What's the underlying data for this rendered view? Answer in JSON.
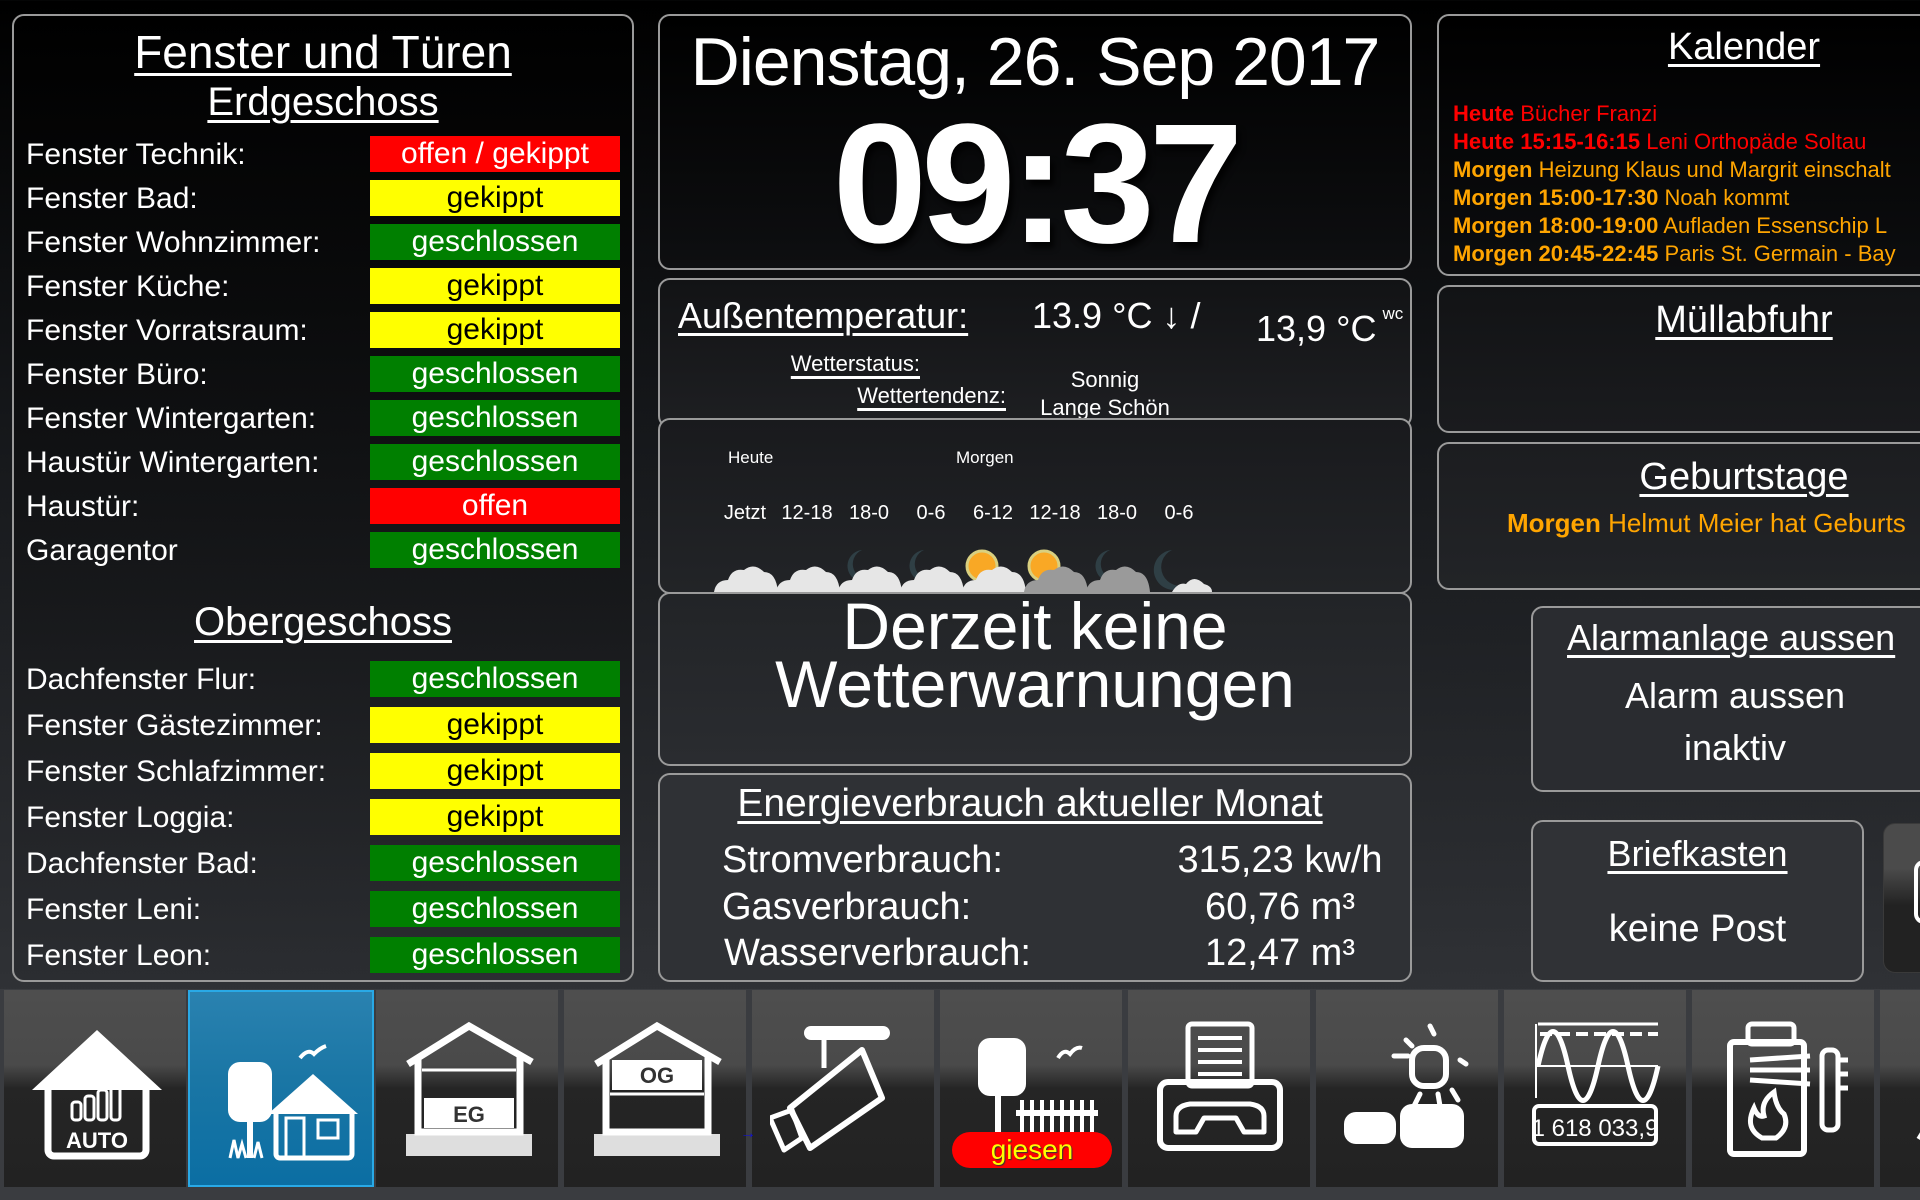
{
  "doors": {
    "title": "Fenster und Türen",
    "eg_title": "Erdgeschoss",
    "og_title": "Obergeschoss",
    "erdgeschoss": [
      {
        "label": "Fenster Technik:",
        "state": "offen / gekippt",
        "color": "red"
      },
      {
        "label": "Fenster Bad:",
        "state": "gekippt",
        "color": "yellow"
      },
      {
        "label": "Fenster Wohnzimmer:",
        "state": "geschlossen",
        "color": "green"
      },
      {
        "label": "Fenster Küche:",
        "state": "gekippt",
        "color": "yellow"
      },
      {
        "label": "Fenster Vorratsraum:",
        "state": "gekippt",
        "color": "yellow"
      },
      {
        "label": "Fenster Büro:",
        "state": "geschlossen",
        "color": "green"
      },
      {
        "label": "Fenster Wintergarten:",
        "state": "geschlossen",
        "color": "green"
      },
      {
        "label": "Haustür Wintergarten:",
        "state": "geschlossen",
        "color": "green"
      },
      {
        "label": "Haustür:",
        "state": "offen",
        "color": "red"
      },
      {
        "label": "Garagentor",
        "state": "geschlossen",
        "color": "green"
      }
    ],
    "obergeschoss": [
      {
        "label": "Dachfenster Flur:",
        "state": "geschlossen",
        "color": "green"
      },
      {
        "label": "Fenster Gästezimmer:",
        "state": "gekippt",
        "color": "yellow"
      },
      {
        "label": "Fenster Schlafzimmer:",
        "state": "gekippt",
        "color": "yellow"
      },
      {
        "label": "Fenster Loggia:",
        "state": "gekippt",
        "color": "yellow"
      },
      {
        "label": "Dachfenster Bad:",
        "state": "geschlossen",
        "color": "green"
      },
      {
        "label": "Fenster Leni:",
        "state": "geschlossen",
        "color": "green"
      },
      {
        "label": "Fenster Leon:",
        "state": "geschlossen",
        "color": "green"
      }
    ]
  },
  "status_colors": {
    "red": "#ff0000",
    "yellow": "#ffff00",
    "green": "#007f00"
  },
  "clock": {
    "date": "Dienstag, 26. Sep 2017",
    "time": "09:37"
  },
  "weather": {
    "temp_label": "Außentemperatur:",
    "temp_value": "13.9 °C ↓  /",
    "windchill_value": "13,9 °C",
    "windchill_suffix": "WC",
    "status_label": "Wetterstatus:",
    "status_value": "Sonnig",
    "trend_label": "Wettertendenz:",
    "trend_value": "Lange Schön",
    "forecast_days": [
      "Heute",
      "Morgen"
    ],
    "forecast": [
      {
        "slot": "Jetzt",
        "icon": "cloudy-icon"
      },
      {
        "slot": "12-18",
        "icon": "cloudy-icon"
      },
      {
        "slot": "18-0",
        "icon": "night-cloudy-icon"
      },
      {
        "slot": "0-6",
        "icon": "night-cloudy-icon"
      },
      {
        "slot": "6-12",
        "icon": "sun-cloudy-icon"
      },
      {
        "slot": "12-18",
        "icon": "sun-dark-cloudy-icon"
      },
      {
        "slot": "18-0",
        "icon": "night-dark-cloudy-icon"
      },
      {
        "slot": "0-6",
        "icon": "night-partly-cloudy-icon"
      }
    ],
    "warning_line1": "Derzeit keine",
    "warning_line2": "Wetterwarnungen"
  },
  "energy": {
    "title": "Energieverbrauch aktueller Monat",
    "rows": [
      {
        "label": "Stromverbrauch:",
        "value": "315,23 kw/h"
      },
      {
        "label": "Gasverbrauch:",
        "value": "60,76 m³"
      },
      {
        "label": "Wasserverbrauch:",
        "value": "12,47 m³"
      }
    ]
  },
  "calendar": {
    "title": "Kalender",
    "events": [
      {
        "when": "Heute",
        "text": "Bücher Franzi",
        "type": "today"
      },
      {
        "when": "Heute 15:15-16:15",
        "text": "Leni Orthopäde Soltau",
        "type": "today"
      },
      {
        "when": "Morgen",
        "text": "Heizung Klaus und Margrit einschalt",
        "type": "tomorrow"
      },
      {
        "when": "Morgen 15:00-17:30",
        "text": "Noah kommt",
        "type": "tomorrow"
      },
      {
        "when": "Morgen 18:00-19:00",
        "text": "Aufladen Essenschip L",
        "type": "tomorrow"
      },
      {
        "when": "Morgen 20:45-22:45",
        "text": "Paris St. Germain - Bay",
        "type": "tomorrow"
      }
    ],
    "colors": {
      "today": "#ff0000",
      "tomorrow": "#ffa500"
    }
  },
  "waste": {
    "title": "Müllabfuhr"
  },
  "birthdays": {
    "title": "Geburtstage",
    "when": "Morgen",
    "text": "Helmut Meier hat Geburts"
  },
  "alarm": {
    "title": "Alarmanlage aussen",
    "line1": "Alarm aussen",
    "line2": "inaktiv"
  },
  "mailbox": {
    "title": "Briefkasten",
    "status": "keine Post"
  },
  "nav": {
    "items": [
      {
        "name": "auto",
        "label": "AUTO",
        "icon": "house-auto-icon"
      },
      {
        "name": "garden-house",
        "label": "",
        "icon": "garden-house-icon",
        "active": true
      },
      {
        "name": "eg",
        "label": "EG",
        "icon": "house-eg-icon"
      },
      {
        "name": "og",
        "label": "OG",
        "icon": "house-og-icon"
      },
      {
        "name": "camera",
        "label": "",
        "icon": "security-camera-icon"
      },
      {
        "name": "garden",
        "label": "giesen",
        "icon": "garden-fence-icon"
      },
      {
        "name": "phone",
        "label": "",
        "icon": "fax-phone-icon"
      },
      {
        "name": "weather",
        "label": "",
        "icon": "weather-sun-clouds-icon"
      },
      {
        "name": "meter",
        "label": "1 618 033,9",
        "icon": "electricity-meter-icon"
      },
      {
        "name": "heating",
        "label": "",
        "icon": "heating-boiler-icon"
      },
      {
        "name": "more",
        "label": "",
        "icon": "warning-triangle-icon"
      }
    ]
  }
}
